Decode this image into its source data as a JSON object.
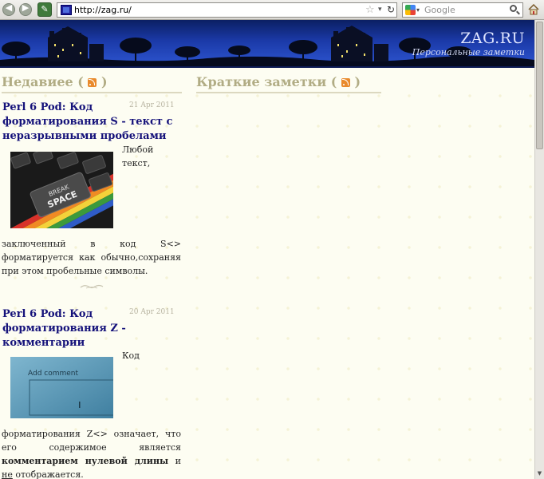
{
  "browser": {
    "url": "http://zag.ru/",
    "search_placeholder": "Google",
    "back_glyph": "◀",
    "forward_glyph": "▶"
  },
  "site": {
    "title": "ZAG.RU",
    "subtitle": "Персональные заметки"
  },
  "sections": {
    "recent_label": "Недавиее (",
    "recent_close": ")",
    "notes_label": "Краткие заметки (",
    "notes_close": ")"
  },
  "posts": [
    {
      "title": "Perl 6 Pod: Код форматирования S - текст с неразрывными пробелами",
      "date": "21 Apr 2011",
      "image_label_1": "BREAK",
      "image_label_2": "SPACE",
      "side_line_1": "Любой",
      "side_line_2": "текст,",
      "body_line_1": "заключенный в код S<>",
      "body_line_2": "форматируется как обычно,сохраняя",
      "body_line_3": "при этом пробельные символы."
    },
    {
      "title": "Perl 6 Pod: Код форматирования Z - комментарии",
      "date": "20 Apr 2011",
      "image_label": "Add comment",
      "side_line_1": "Код",
      "body_line_1": "форматирования Z<> означает, что",
      "body_line_2": "его содержимое является",
      "body_bold": "комментарием нулевой длины",
      "body_after_bold": " и",
      "body_underlined": "не",
      "body_end": " отображается."
    }
  ],
  "colors": {
    "heading": "#b1ac84",
    "post_title": "#15127a",
    "rss": "#e98a2c"
  }
}
